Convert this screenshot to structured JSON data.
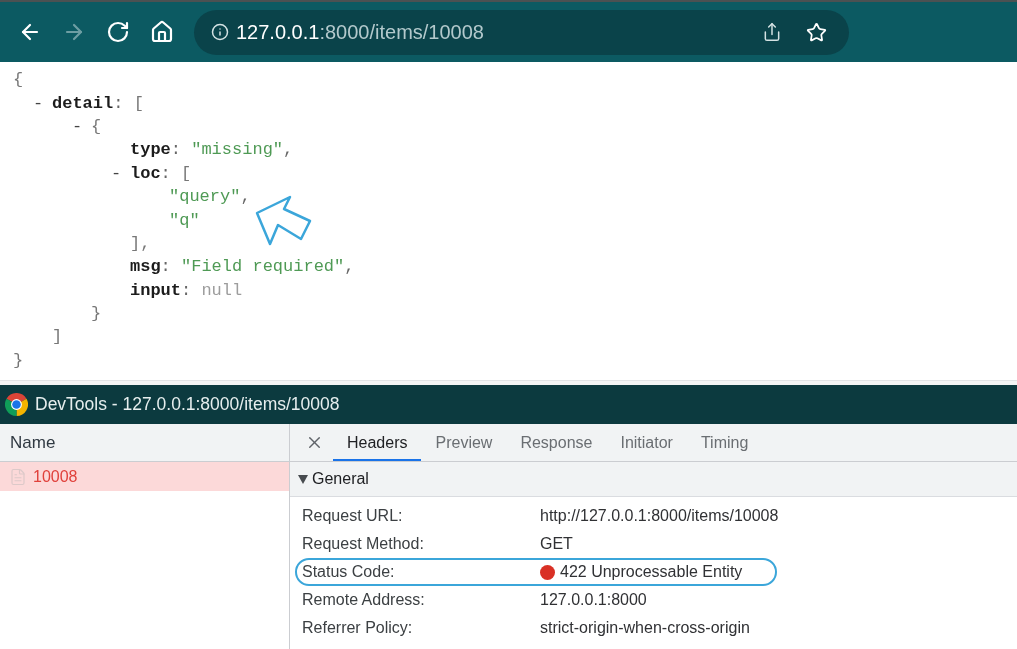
{
  "browser": {
    "nav_buttons": [
      {
        "kind": "back",
        "disabled": false
      },
      {
        "kind": "forward",
        "disabled": true
      },
      {
        "kind": "reload",
        "disabled": false
      },
      {
        "kind": "home",
        "disabled": false
      }
    ],
    "address": {
      "host": "127.0.0.1",
      "path": ":8000/items/10008"
    },
    "bookmarked": false
  },
  "json_viewer": {
    "root": {
      "open": "{",
      "children": [
        {
          "toggle": "-",
          "key": "detail",
          "sep": ": ",
          "open": "[",
          "children": [
            {
              "toggle": "-",
              "open": "{",
              "children": [
                {
                  "key": "type",
                  "sep": ": ",
                  "value": "\"missing\"",
                  "kind": "string",
                  "comma": ","
                },
                {
                  "toggle": "-",
                  "key": "loc",
                  "sep": ": ",
                  "open": "[",
                  "children": [
                    {
                      "value": "\"query\"",
                      "kind": "string",
                      "comma": ",",
                      "arrow_annotation": true
                    },
                    {
                      "value": "\"q\"",
                      "kind": "string"
                    }
                  ],
                  "close": "],"
                },
                {
                  "key": "msg",
                  "sep": ": ",
                  "value": "\"Field required\"",
                  "kind": "string",
                  "comma": ","
                },
                {
                  "key": "input",
                  "sep": ": ",
                  "value": "null",
                  "kind": "null"
                }
              ],
              "close": "}"
            }
          ],
          "close": "]"
        }
      ],
      "close": "}"
    }
  },
  "devtools": {
    "title": "DevTools - 127.0.0.1:8000/items/10008",
    "requests": {
      "column": "Name",
      "rows": [
        {
          "name": "10008",
          "selected": true,
          "failed": true
        }
      ]
    },
    "tabs": [
      {
        "label": "Headers",
        "selected": true
      },
      {
        "label": "Preview",
        "selected": false
      },
      {
        "label": "Response",
        "selected": false
      },
      {
        "label": "Initiator",
        "selected": false
      },
      {
        "label": "Timing",
        "selected": false
      }
    ],
    "general": {
      "title": "General",
      "expanded": true,
      "rows": [
        {
          "label": "Request URL:",
          "value": "http://127.0.0.1:8000/items/10008",
          "highlighted": false
        },
        {
          "label": "Request Method:",
          "value": "GET",
          "highlighted": false
        },
        {
          "label": "Status Code:",
          "value": "422 Unprocessable Entity",
          "color": "#d93025",
          "highlighted": true
        },
        {
          "label": "Remote Address:",
          "value": "127.0.0.1:8000",
          "highlighted": false
        },
        {
          "label": "Referrer Policy:",
          "value": "strict-origin-when-cross-origin",
          "highlighted": false
        }
      ]
    }
  }
}
